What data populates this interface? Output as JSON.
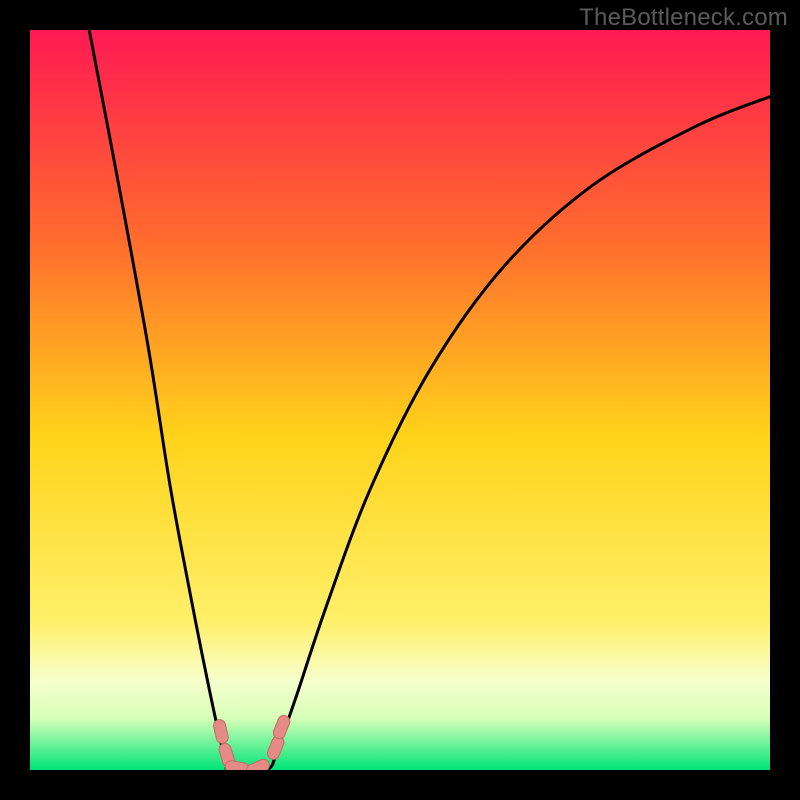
{
  "watermark": "TheBottleneck.com",
  "colors": {
    "background": "#000000",
    "gradient_top": "#ff1a53",
    "gradient_upper_mid": "#ff6a2e",
    "gradient_mid": "#ffd31a",
    "gradient_lower_mid": "#fff8b0",
    "gradient_band": "#f6ffcc",
    "gradient_bottom": "#00e57a",
    "curve": "#000000",
    "marker_fill": "#e58b85",
    "marker_stroke": "#c46a63"
  },
  "chart_data": {
    "type": "line",
    "title": "",
    "xlabel": "",
    "ylabel": "",
    "x_range": [
      0,
      100
    ],
    "y_range": [
      0,
      100
    ],
    "series": [
      {
        "name": "left-branch",
        "x": [
          8,
          12,
          16,
          19,
          22,
          24,
          25.5,
          26.5,
          27
        ],
        "y": [
          100,
          79,
          57,
          38,
          22,
          12,
          5,
          1,
          0
        ]
      },
      {
        "name": "floor",
        "x": [
          27,
          32
        ],
        "y": [
          0,
          0
        ]
      },
      {
        "name": "right-branch",
        "x": [
          32,
          33.5,
          36,
          40,
          46,
          54,
          64,
          76,
          90,
          100
        ],
        "y": [
          0,
          3,
          10,
          22,
          38,
          54,
          68,
          79,
          87,
          91
        ]
      }
    ],
    "markers": [
      {
        "name": "left-dip-top",
        "x": 25.8,
        "y": 5.2
      },
      {
        "name": "left-dip-bottom",
        "x": 26.6,
        "y": 2.0
      },
      {
        "name": "floor-left",
        "x": 28.0,
        "y": 0.3
      },
      {
        "name": "floor-right",
        "x": 30.8,
        "y": 0.3
      },
      {
        "name": "right-rise-bottom",
        "x": 33.2,
        "y": 3.0
      },
      {
        "name": "right-rise-top",
        "x": 34.0,
        "y": 5.8
      }
    ]
  }
}
